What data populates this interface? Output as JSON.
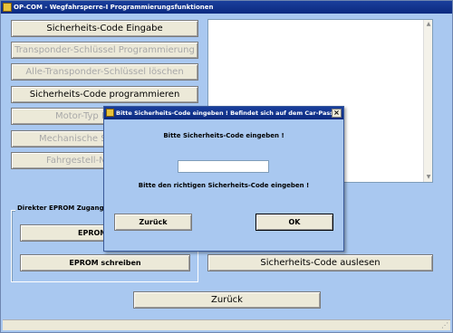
{
  "window": {
    "title": "OP-COM - Wegfahrsperre-I Programmierungsfunktionen"
  },
  "left_buttons": [
    {
      "label": "Sicherheits-Code Eingabe",
      "disabled": false
    },
    {
      "label": "Transponder-Schlüssel Programmierung",
      "disabled": true
    },
    {
      "label": "Alle-Transponder-Schlüssel löschen",
      "disabled": true
    },
    {
      "label": "Sicherheits-Code programmieren",
      "disabled": false
    },
    {
      "label": "Motor-Typ Pro",
      "disabled": true
    },
    {
      "label": "Mechanische Schlüss",
      "disabled": true
    },
    {
      "label": "Fahrgestell-Nr. E",
      "disabled": true
    }
  ],
  "eprom_group": {
    "label": "Direkter EPROM Zugang ! !",
    "read_label": "EPROM",
    "write_label": "EPROM schreiben"
  },
  "read_code_button": "Sicherheits-Code auslesen",
  "back_button": "Zurück",
  "dialog": {
    "title": "Bitte Sicherheits-Code eingeben ! Befindet sich auf dem Car-Pass",
    "prompt": "Bitte Sicherheits-Code eingeben !",
    "input_value": "",
    "hint": "Bitte den richtigen Sicherheits-Code eingeben !",
    "back_label": "Zurück",
    "ok_label": "OK",
    "close_glyph": "×"
  }
}
